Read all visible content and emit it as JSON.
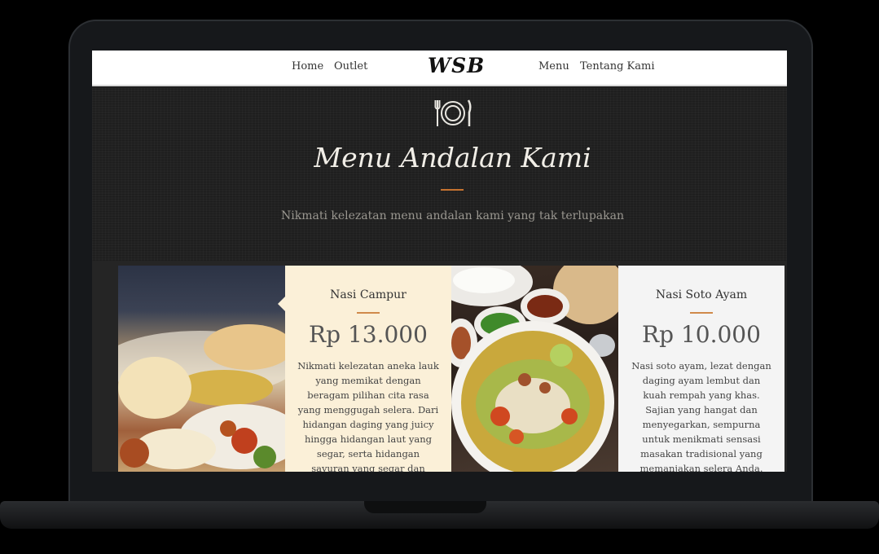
{
  "nav": {
    "home": "Home",
    "outlet": "Outlet",
    "logo": "WSB",
    "menu": "Menu",
    "about": "Tentang Kami"
  },
  "hero": {
    "title": "Menu Andalan Kami",
    "subtitle": "Nikmati kelezatan menu andalan kami yang tak terlupakan"
  },
  "menu_items": [
    {
      "name": "Nasi Campur",
      "price": "Rp 13.000",
      "description": "Nikmati kelezatan aneka lauk yang memikat dengan beragam pilihan cita rasa yang menggugah selera. Dari hidangan daging yang juicy hingga hidangan laut yang segar, serta hidangan sayuran yang segar dan rempah, setiap suap"
    },
    {
      "name": "Nasi Soto Ayam",
      "price": "Rp 10.000",
      "description": "Nasi soto ayam, lezat dengan daging ayam lembut dan kuah rempah yang khas. Sajian yang hangat dan menyegarkan, sempurna untuk menikmati sensasi masakan tradisional yang memanjakan selera Anda."
    }
  ],
  "colors": {
    "accent": "#c5722f",
    "card_campur_bg": "#fbf0d8",
    "card_soto_bg": "#f4f4f4",
    "hero_bg": "#222222"
  },
  "icons": {
    "hero": "plate-fork-knife-icon"
  }
}
